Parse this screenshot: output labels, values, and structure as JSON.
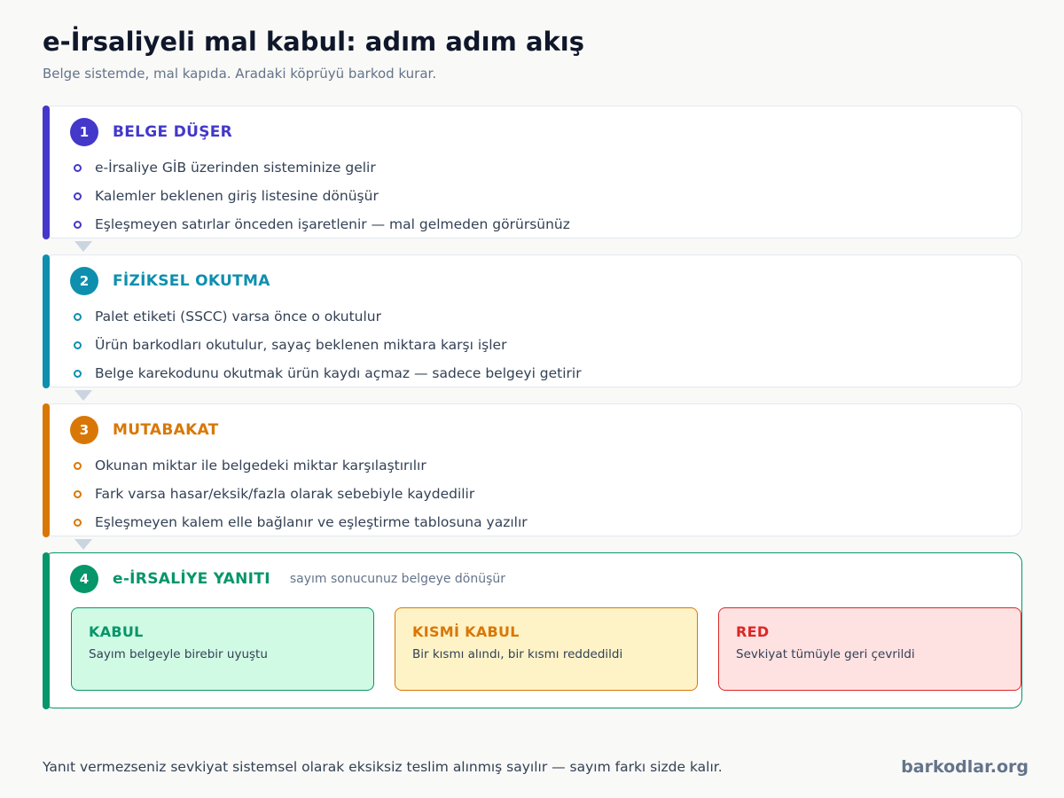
{
  "header": {
    "title": "e-İrsaliyeli mal kabul: adım adım akış",
    "subtitle": "Belge sistemde, mal kapıda. Aradaki köprüyü barkod kurar."
  },
  "colors": {
    "step1": "#4338ca",
    "step2": "#0e8fae",
    "step3": "#d97706",
    "step4": "#059669",
    "red": "#dc2626"
  },
  "steps": [
    {
      "number": "1",
      "title": "BELGE DÜŞER",
      "bullets": [
        "e-İrsaliye GİB üzerinden sisteminize gelir",
        "Kalemler beklenen giriş listesine dönüşür",
        "Eşleşmeyen satırlar önceden işaretlenir — mal gelmeden görürsünüz"
      ]
    },
    {
      "number": "2",
      "title": "FİZİKSEL OKUTMA",
      "bullets": [
        "Palet etiketi (SSCC) varsa önce o okutulur",
        "Ürün barkodları okutulur, sayaç beklenen miktara karşı işler",
        "Belge karekodunu okutmak ürün kaydı açmaz — sadece belgeyi getirir"
      ]
    },
    {
      "number": "3",
      "title": "MUTABAKAT",
      "bullets": [
        "Okunan miktar ile belgedeki miktar karşılaştırılır",
        "Fark varsa hasar/eksik/fazla olarak sebebiyle kaydedilir",
        "Eşleşmeyen kalem elle bağlanır ve eşleştirme tablosuna yazılır"
      ]
    },
    {
      "number": "4",
      "title": "e-İRSALİYE YANITI",
      "note": "sayım sonucunuz belgeye dönüşür",
      "outcomes": [
        {
          "title": "KABUL",
          "desc": "Sayım belgeyle birebir uyuştu"
        },
        {
          "title": "KISMİ KABUL",
          "desc": "Bir kısmı alındı, bir kısmı reddedildi"
        },
        {
          "title": "RED",
          "desc": "Sevkiyat tümüyle geri çevrildi"
        }
      ]
    }
  ],
  "footer": {
    "note": "Yanıt vermezseniz sevkiyat sistemsel olarak eksiksiz teslim alınmış sayılır — sayım farkı sizde kalır.",
    "brand": "barkodlar.org"
  }
}
